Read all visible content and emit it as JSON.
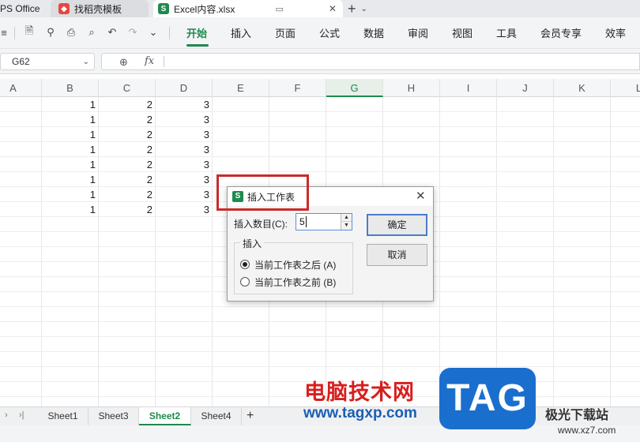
{
  "tabs": [
    {
      "label": "PS Office"
    },
    {
      "label": "找稻壳模板"
    },
    {
      "label": "Excel内容.xlsx"
    }
  ],
  "menu": [
    "开始",
    "插入",
    "页面",
    "公式",
    "数据",
    "审阅",
    "视图",
    "工具",
    "会员专享",
    "效率"
  ],
  "formula_bar": {
    "cell_ref": "G62",
    "fx": "fx",
    "value": ""
  },
  "columns": [
    "A",
    "B",
    "C",
    "D",
    "E",
    "F",
    "G",
    "H",
    "I",
    "J",
    "K",
    "L"
  ],
  "selected_column": "G",
  "rows": [
    [
      "1",
      "2",
      "3"
    ],
    [
      "1",
      "2",
      "3"
    ],
    [
      "1",
      "2",
      "3"
    ],
    [
      "1",
      "2",
      "3"
    ],
    [
      "1",
      "2",
      "3"
    ],
    [
      "1",
      "2",
      "3"
    ],
    [
      "1",
      "2",
      "3"
    ],
    [
      "1",
      "2",
      "3"
    ]
  ],
  "sheets": [
    "Sheet1",
    "Sheet3",
    "Sheet2",
    "Sheet4"
  ],
  "active_sheet": "Sheet2",
  "dialog": {
    "icon_letter": "S",
    "title": "插入工作表",
    "count_label": "插入数目(C):",
    "count_value": "5",
    "group_label": "插入",
    "option_after": "当前工作表之后 (A)",
    "option_before": "当前工作表之前 (B)",
    "selected_option": "after",
    "ok_label": "确定",
    "cancel_label": "取消"
  },
  "watermark": {
    "site_name": "电脑技术网",
    "url": "www.tagxp.com",
    "badge": "TAG",
    "brand": "极光下载站",
    "brand_url": "www.xz7.com"
  },
  "colors": {
    "accent": "#1e8a4c",
    "highlight_box": "#cc2a2a",
    "watermark_blue": "#1a6fce"
  }
}
